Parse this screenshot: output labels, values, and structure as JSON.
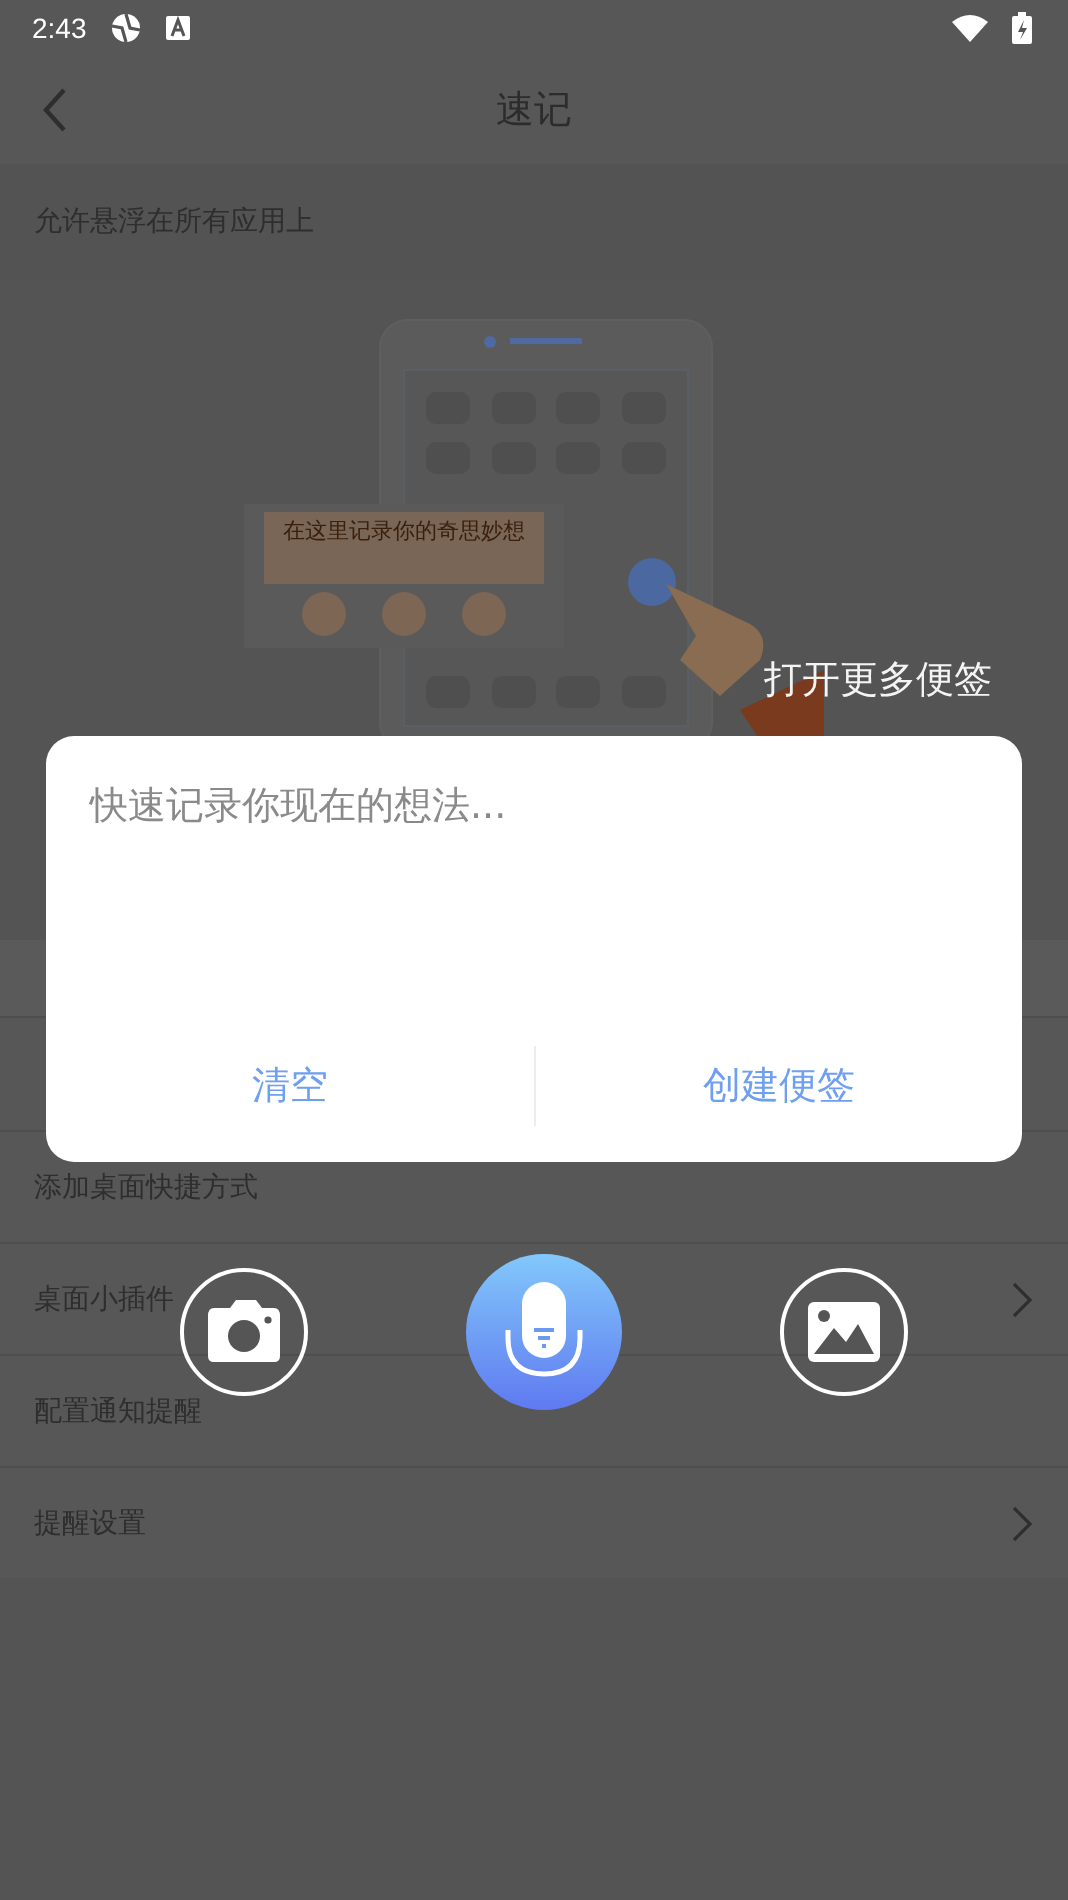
{
  "status_bar": {
    "time": "2:43"
  },
  "header": {
    "title": "速记"
  },
  "float_permission": {
    "label": "允许悬浮在所有应用上"
  },
  "illustration": {
    "caption": "在这里记录你的奇思妙想"
  },
  "hint": "打开更多便签",
  "settings": [
    {
      "label": "添加桌面快捷方式",
      "kind": "plain"
    },
    {
      "label": "桌面小插件",
      "kind": "link"
    },
    {
      "label": "配置通知提醒",
      "kind": "plain"
    },
    {
      "label": "提醒设置",
      "kind": "link"
    }
  ],
  "dialog": {
    "placeholder": "快速记录你现在的想法...",
    "buttons": [
      "清空",
      "创建便签"
    ]
  }
}
